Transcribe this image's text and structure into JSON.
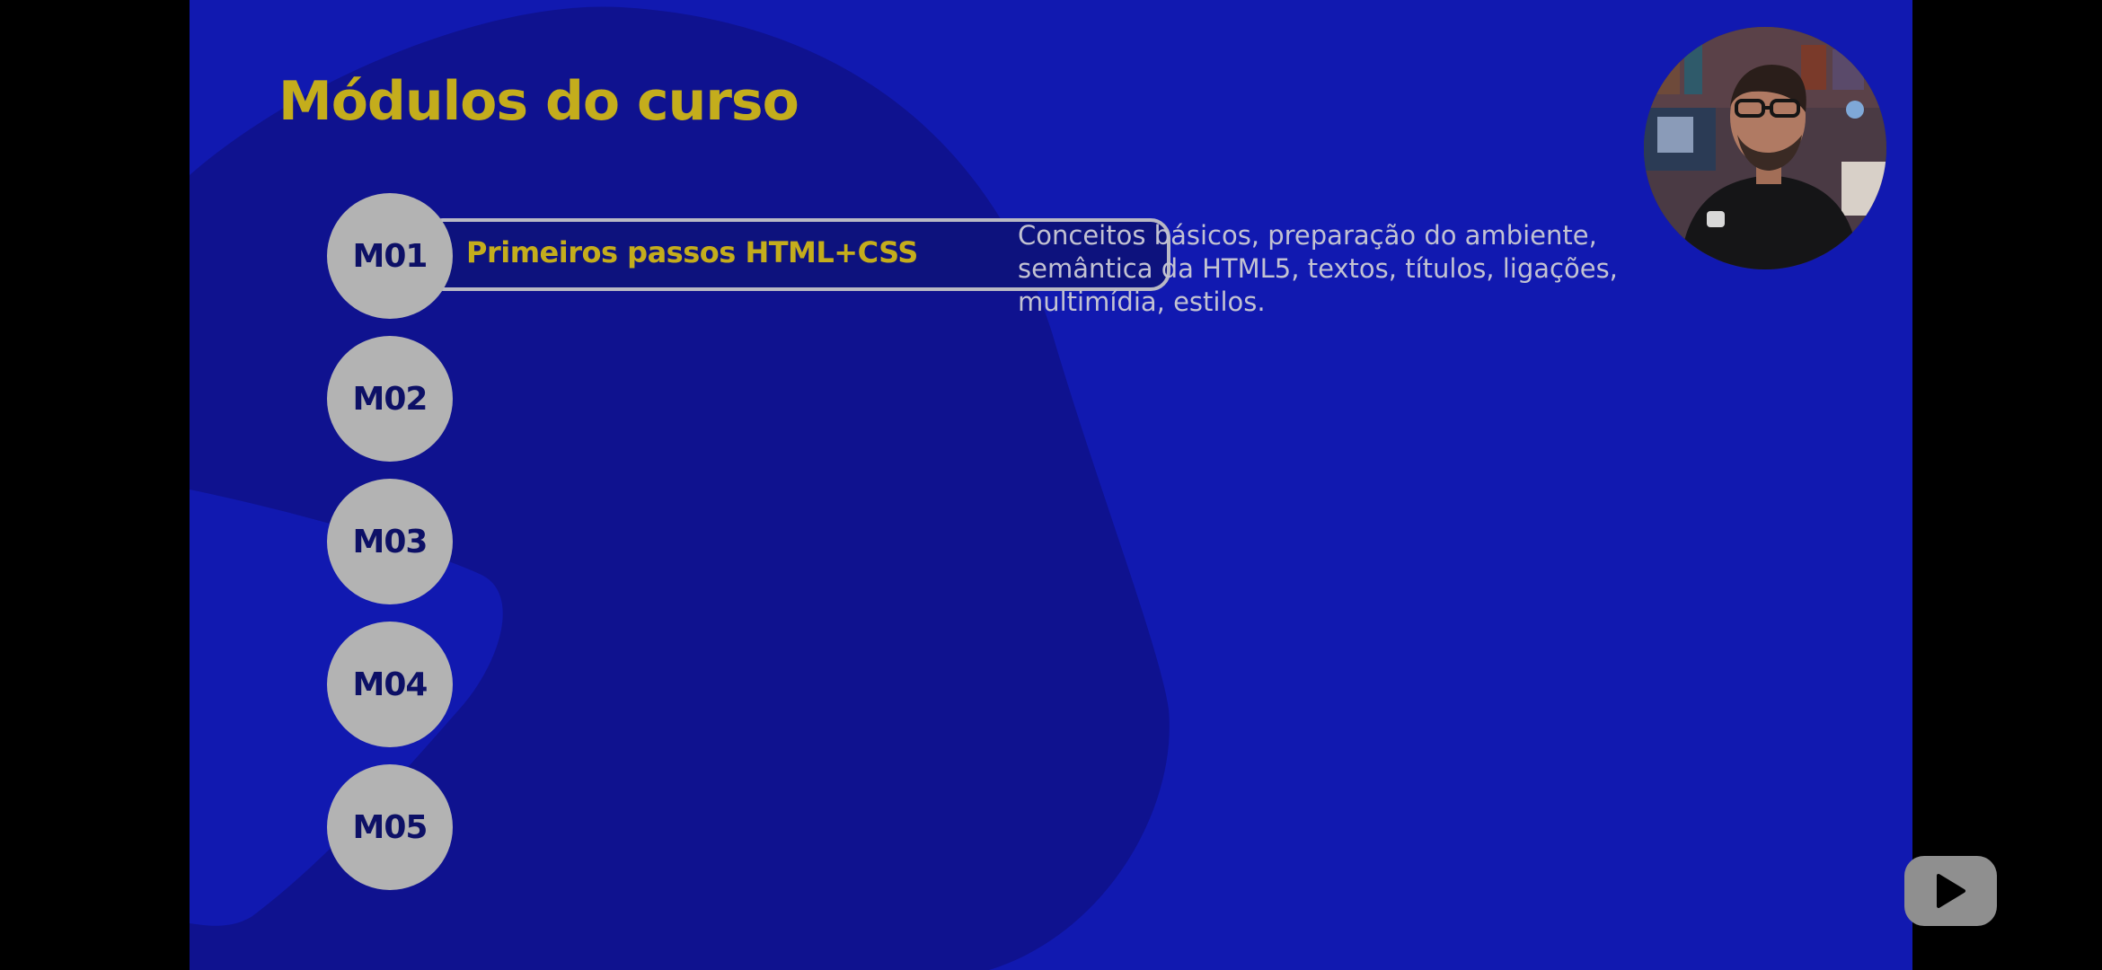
{
  "slide": {
    "title": "Módulos do curso",
    "active_module": {
      "code": "M01",
      "title": "Primeiros passos HTML+CSS",
      "description": "Conceitos básicos, preparação do ambiente, semântica da HTML5, textos, títulos, ligações, multimídia, estilos."
    },
    "modules": [
      "M01",
      "M02",
      "M03",
      "M04",
      "M05"
    ]
  },
  "colors": {
    "background": "#1119b0",
    "blob": "#0f128f",
    "title": "#c4ad1c",
    "circle": "#b3b3b3",
    "circle_text": "#0d1066",
    "description": "#c2c2d2"
  },
  "icons": {
    "play": "play-icon",
    "presenter": "presenter-webcam"
  }
}
